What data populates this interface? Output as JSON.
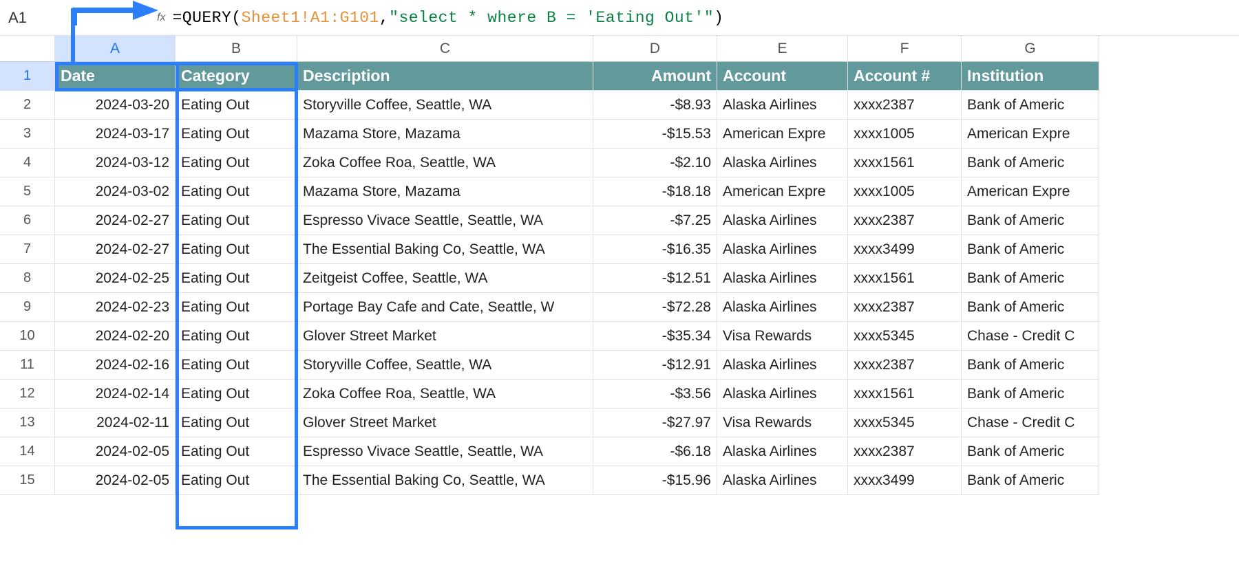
{
  "formula": {
    "cellRef": "A1",
    "equals": "=",
    "func": "QUERY",
    "openParen": "(",
    "range": "Sheet1!A1:G101",
    "comma": ",",
    "queryString": "\"select * where B = 'Eating Out'\"",
    "closeParen": ")"
  },
  "columns": [
    "A",
    "B",
    "C",
    "D",
    "E",
    "F",
    "G"
  ],
  "headers": {
    "date": "Date",
    "category": "Category",
    "description": "Description",
    "amount": "Amount",
    "account": "Account",
    "accountNum": "Account #",
    "institution": "Institution"
  },
  "rows": [
    {
      "n": "1"
    },
    {
      "n": "2",
      "date": "2024-03-20",
      "category": "Eating Out",
      "description": "Storyville Coffee, Seattle, WA",
      "amount": "-$8.93",
      "account": "Alaska Airlines",
      "accountNum": "xxxx2387",
      "institution": "Bank of Americ"
    },
    {
      "n": "3",
      "date": "2024-03-17",
      "category": "Eating Out",
      "description": "Mazama Store, Mazama",
      "amount": "-$15.53",
      "account": "American Expre",
      "accountNum": "xxxx1005",
      "institution": "American Expre"
    },
    {
      "n": "4",
      "date": "2024-03-12",
      "category": "Eating Out",
      "description": "Zoka Coffee Roa, Seattle, WA",
      "amount": "-$2.10",
      "account": "Alaska Airlines",
      "accountNum": "xxxx1561",
      "institution": "Bank of Americ"
    },
    {
      "n": "5",
      "date": "2024-03-02",
      "category": "Eating Out",
      "description": "Mazama Store, Mazama",
      "amount": "-$18.18",
      "account": "American Expre",
      "accountNum": "xxxx1005",
      "institution": "American Expre"
    },
    {
      "n": "6",
      "date": "2024-02-27",
      "category": "Eating Out",
      "description": "Espresso Vivace Seattle, Seattle, WA",
      "amount": "-$7.25",
      "account": "Alaska Airlines",
      "accountNum": "xxxx2387",
      "institution": "Bank of Americ"
    },
    {
      "n": "7",
      "date": "2024-02-27",
      "category": "Eating Out",
      "description": "The Essential Baking Co, Seattle, WA",
      "amount": "-$16.35",
      "account": "Alaska Airlines",
      "accountNum": "xxxx3499",
      "institution": "Bank of Americ"
    },
    {
      "n": "8",
      "date": "2024-02-25",
      "category": "Eating Out",
      "description": "Zeitgeist Coffee, Seattle, WA",
      "amount": "-$12.51",
      "account": "Alaska Airlines",
      "accountNum": "xxxx1561",
      "institution": "Bank of Americ"
    },
    {
      "n": "9",
      "date": "2024-02-23",
      "category": "Eating Out",
      "description": "Portage Bay Cafe and Cate, Seattle, W",
      "amount": "-$72.28",
      "account": "Alaska Airlines",
      "accountNum": "xxxx2387",
      "institution": "Bank of Americ"
    },
    {
      "n": "10",
      "date": "2024-02-20",
      "category": "Eating Out",
      "description": "Glover Street Market",
      "amount": "-$35.34",
      "account": "Visa Rewards",
      "accountNum": "xxxx5345",
      "institution": "Chase - Credit C"
    },
    {
      "n": "11",
      "date": "2024-02-16",
      "category": "Eating Out",
      "description": "Storyville Coffee, Seattle, WA",
      "amount": "-$12.91",
      "account": "Alaska Airlines",
      "accountNum": "xxxx2387",
      "institution": "Bank of Americ"
    },
    {
      "n": "12",
      "date": "2024-02-14",
      "category": "Eating Out",
      "description": "Zoka Coffee Roa, Seattle, WA",
      "amount": "-$3.56",
      "account": "Alaska Airlines",
      "accountNum": "xxxx1561",
      "institution": "Bank of Americ"
    },
    {
      "n": "13",
      "date": "2024-02-11",
      "category": "Eating Out",
      "description": "Glover Street Market",
      "amount": "-$27.97",
      "account": "Visa Rewards",
      "accountNum": "xxxx5345",
      "institution": "Chase - Credit C"
    },
    {
      "n": "14",
      "date": "2024-02-05",
      "category": "Eating Out",
      "description": "Espresso Vivace Seattle, Seattle, WA",
      "amount": "-$6.18",
      "account": "Alaska Airlines",
      "accountNum": "xxxx2387",
      "institution": "Bank of Americ"
    },
    {
      "n": "15",
      "date": "2024-02-05",
      "category": "Eating Out",
      "description": "The Essential Baking Co, Seattle, WA",
      "amount": "-$15.96",
      "account": "Alaska Airlines",
      "accountNum": "xxxx3499",
      "institution": "Bank of Americ"
    }
  ]
}
